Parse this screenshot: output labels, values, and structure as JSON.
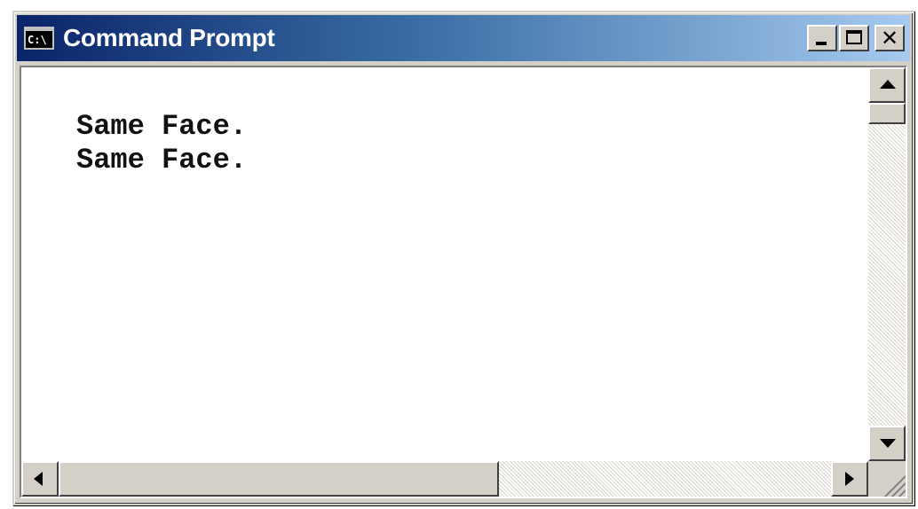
{
  "window": {
    "title": "Command Prompt",
    "icon": "cmd-icon",
    "icon_text": "C:\\"
  },
  "titlebar_buttons": {
    "minimize": "minimize-icon",
    "maximize": "maximize-icon",
    "close": "close-icon",
    "close_glyph": "✕"
  },
  "console": {
    "lines": [
      "Same Face.",
      "Same Face."
    ],
    "background": "#ffffff",
    "text_color": "#111111"
  },
  "scrollbars": {
    "vertical": {
      "up": "arrow-up-icon",
      "down": "arrow-down-icon"
    },
    "horizontal": {
      "left": "arrow-left-icon",
      "right": "arrow-right-icon"
    }
  },
  "colors": {
    "titlebar_start": "#0a246a",
    "titlebar_end": "#a6caf0",
    "chrome": "#d4d0c8"
  }
}
